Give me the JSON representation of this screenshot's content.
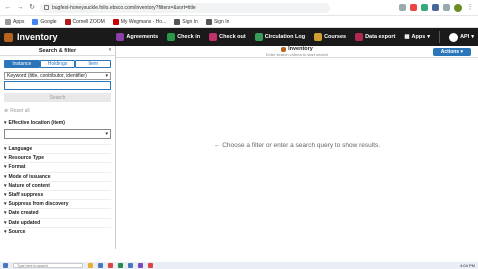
{
  "browser": {
    "url": "bugfest-honeysuckle.folio.ebsco.com/inventory?filters=&sort=title",
    "bookmarks": [
      "Apps",
      "Google",
      "Cornell ZOOM",
      "My Wegmans - Ho...",
      "Sign In",
      "Sign In"
    ]
  },
  "header": {
    "brand": "Inventory",
    "apps": [
      {
        "label": "Agreements",
        "color": "#8b3fa8"
      },
      {
        "label": "Check in",
        "color": "#2a9a4a"
      },
      {
        "label": "Check out",
        "color": "#c0306a"
      },
      {
        "label": "Circulation Log",
        "color": "#3a9a5a"
      },
      {
        "label": "Courses",
        "color": "#d0a030"
      },
      {
        "label": "Data export",
        "color": "#b02a50"
      }
    ],
    "apps_menu": "Apps",
    "user": "API"
  },
  "sidebar": {
    "title": "Search & filter",
    "segments": [
      "Instance",
      "Holdings",
      "Item"
    ],
    "search_option": "Keyword (title, contributor, identifier)",
    "search_button": "Search",
    "reset": "Reset all",
    "location_label": "Effective location (item)",
    "facets": [
      "Language",
      "Resource Type",
      "Format",
      "Mode of issuance",
      "Nature of content",
      "Staff suppress",
      "Suppress from discovery",
      "Date created",
      "Date updated",
      "Source"
    ]
  },
  "results": {
    "title": "Inventory",
    "subtitle": "Enter search criteria to start search",
    "actions": "Actions",
    "empty_message": "Choose a filter or enter a search query to show results."
  },
  "taskbar": {
    "search_placeholder": "Type here to search",
    "time": "4:04 PM"
  }
}
